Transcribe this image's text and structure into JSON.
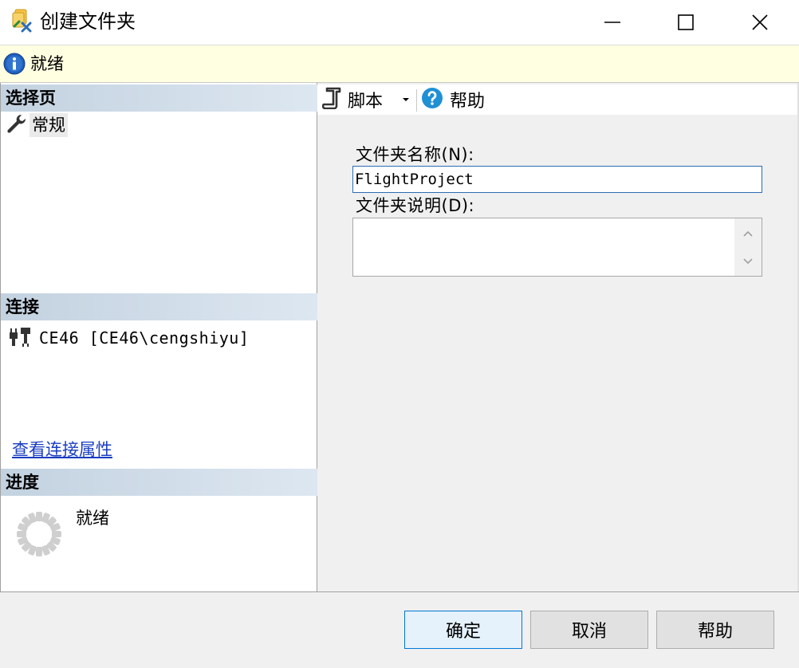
{
  "window": {
    "title": "创建文件夹",
    "icon": "folder-new-icon"
  },
  "infobar": {
    "icon": "info-icon",
    "text": "就绪"
  },
  "left_pane": {
    "pages_header": "选择页",
    "pages": [
      {
        "label": "常规",
        "icon": "wrench-icon"
      }
    ],
    "connection_header": "连接",
    "connection": {
      "label": "CE46 [CE46\\cengshiyu]",
      "icon": "plug-icon"
    },
    "connection_link": "查看连接属性",
    "progress_header": "进度",
    "progress_text": "就绪"
  },
  "toolbar": {
    "script_label": "脚本",
    "help_label": "帮助"
  },
  "form": {
    "name_label": "文件夹名称(N):",
    "name_value": "FlightProject",
    "desc_label": "文件夹说明(D):",
    "desc_value": ""
  },
  "footer": {
    "ok_label": "确定",
    "cancel_label": "取消",
    "help_label": "帮助"
  },
  "colors": {
    "infobar_bg": "#ffffe1",
    "header_gradient_start": "#c3d2e0",
    "header_gradient_end": "#dde7f1",
    "link": "#1a3dc1",
    "accent": "#0078d7",
    "help_icon": "#1e90d6"
  }
}
